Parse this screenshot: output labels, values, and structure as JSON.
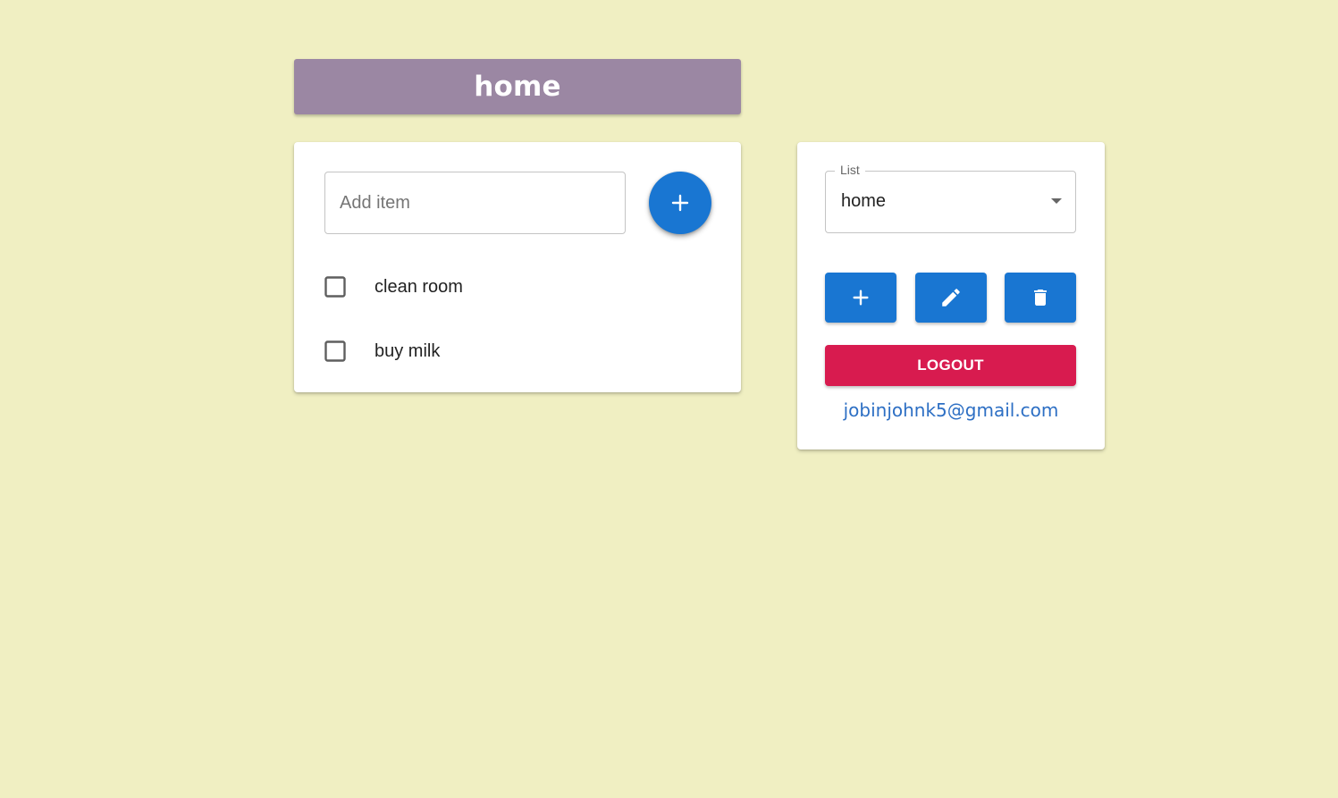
{
  "header": {
    "title": "home"
  },
  "todo": {
    "input_placeholder": "Add item",
    "input_value": "",
    "items": [
      {
        "label": "clean room",
        "checked": false
      },
      {
        "label": "buy milk",
        "checked": false
      }
    ]
  },
  "sidebar": {
    "select_label": "List",
    "selected_list": "home",
    "logout_label": "LOGOUT",
    "user_email": "jobinjohnk5@gmail.com"
  },
  "colors": {
    "background": "#f0efc2",
    "title_bar": "#9b87a3",
    "primary": "#1976d2",
    "danger": "#d81b4f",
    "email_link": "#2d6fc4"
  },
  "icons": {
    "fab": "plus-icon",
    "add_list": "plus-icon",
    "edit_list": "pencil-icon",
    "delete_list": "trash-icon",
    "select_dropdown": "caret-down-icon",
    "checkbox": "checkbox-unchecked-icon"
  }
}
